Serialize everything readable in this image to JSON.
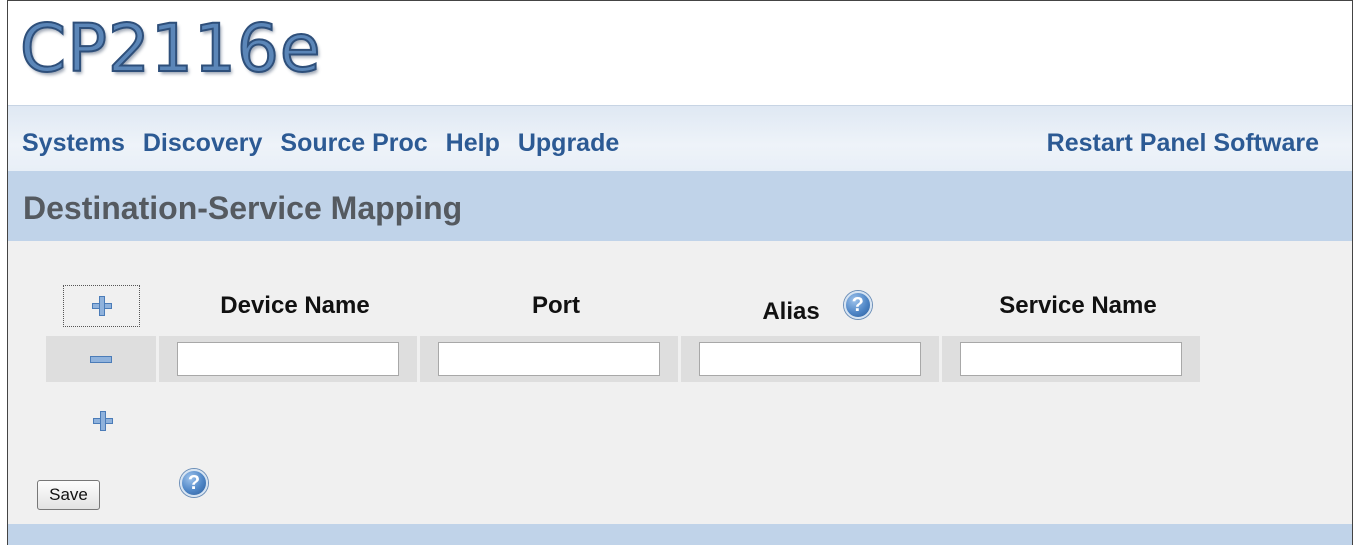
{
  "app": {
    "logo_text": "CP2116e"
  },
  "nav": {
    "links": [
      "Systems",
      "Discovery",
      "Source Proc",
      "Help",
      "Upgrade"
    ],
    "right_link": "Restart Panel Software"
  },
  "page": {
    "title": "Destination-Service Mapping"
  },
  "table": {
    "columns": [
      "Device Name",
      "Port",
      "Alias",
      "Service Name"
    ],
    "rows": [
      {
        "device_name": "",
        "port": "",
        "alias": "",
        "service_name": ""
      }
    ]
  },
  "actions": {
    "save_label": "Save"
  },
  "icons": {
    "add": "plus-icon",
    "remove": "minus-icon",
    "help": "help-icon"
  },
  "colors": {
    "nav_text": "#2c5a94",
    "title_bar": "#c0d3e9",
    "logo": "#5b86b8"
  }
}
